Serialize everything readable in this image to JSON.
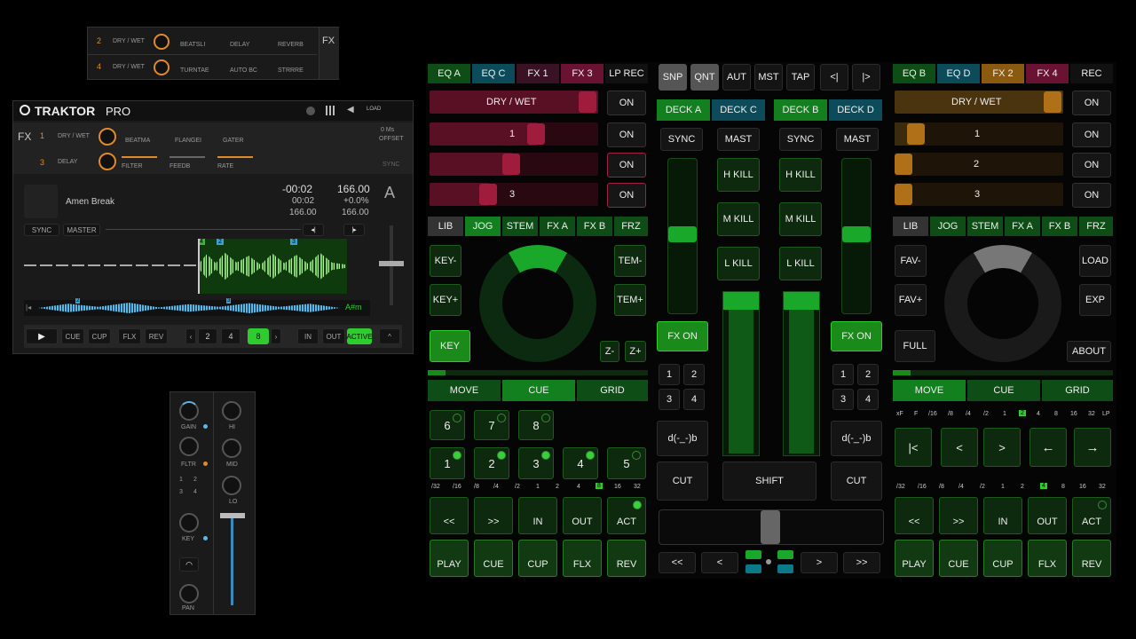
{
  "fx_mini": {
    "rows": [
      {
        "num": "2",
        "mode": "DRY / WET",
        "slots": [
          "BEATSLI",
          "DELAY",
          "REVERB"
        ]
      },
      {
        "num": "4",
        "mode": "DRY / WET",
        "slots": [
          "TURNTAE",
          "AUTO BC",
          "STRRRE"
        ]
      }
    ],
    "fx_label": "FX"
  },
  "traktor": {
    "logo": "TRAKTOR",
    "logo_suffix": "PRO",
    "load_label": "LOAD",
    "fx_label": "FX",
    "fx_rows": [
      {
        "num": "1",
        "mode": "DRY / WET",
        "slots": [
          "BEATMA",
          "FLANGEI",
          "GATER"
        ]
      },
      {
        "num": "3",
        "mode": "DELAY",
        "slots": [
          "FILTER",
          "FEEDB",
          "RATE"
        ]
      }
    ],
    "offset_ms": "0 Ms",
    "offset_label": "OFFSET",
    "sync_label": "SYNC",
    "track": {
      "title": "Amen Break",
      "time_remaining": "-00:02",
      "bpm": "166.00",
      "time": "00:02",
      "pitch": "+0.0%",
      "bpm2": "166.00",
      "bpm3": "166.00",
      "deck_letter": "A",
      "key": "A#m"
    },
    "buttons": {
      "sync": "SYNC",
      "master": "MASTER"
    },
    "transport": {
      "cue": "CUE",
      "cup": "CUP",
      "flx": "FLX",
      "rev": "REV",
      "loop_sizes": [
        "2",
        "4",
        "8"
      ],
      "in": "IN",
      "out": "OUT",
      "active": "ACTIVE"
    },
    "cue_markers": [
      "4",
      "2",
      "3",
      "2",
      "3"
    ]
  },
  "mixer_strip": {
    "gain": "GAIN",
    "filter": "FLTR",
    "key": "KEY",
    "pan": "PAN",
    "hi": "HI",
    "mid": "MID",
    "lo": "LO",
    "fx_assign": [
      "1",
      "2",
      "3",
      "4"
    ]
  },
  "controller": {
    "left": {
      "tabs": [
        "EQ A",
        "EQ C",
        "FX 1",
        "FX 3",
        "LP REC"
      ],
      "drywet": "DRY / WET",
      "rows": [
        "1",
        "2",
        "3"
      ],
      "on": "ON",
      "modes": [
        "LIB",
        "JOG",
        "STEM",
        "FX A",
        "FX B",
        "FRZ"
      ],
      "key_minus": "KEY-",
      "key_plus": "KEY+",
      "key": "KEY",
      "tem_minus": "TEM-",
      "tem_plus": "TEM+",
      "z_minus": "Z-",
      "z_plus": "Z+",
      "cue_modes": [
        "MOVE",
        "CUE",
        "GRID"
      ],
      "pads_top": [
        "6",
        "7",
        "8"
      ],
      "pads_bottom": [
        "1",
        "2",
        "3",
        "4",
        "5"
      ],
      "loop_sizes": [
        "/32",
        "/16",
        "/8",
        "/4",
        "/2",
        "1",
        "2",
        "4",
        "8",
        "16",
        "32"
      ],
      "loop_active": "8",
      "nav": [
        "<<",
        ">>",
        "IN",
        "OUT",
        "ACT"
      ],
      "transport": [
        "PLAY",
        "CUE",
        "CUP",
        "FLX",
        "REV"
      ]
    },
    "center": {
      "top": [
        "SNP",
        "QNT",
        "AUT",
        "MST",
        "TAP",
        "<|",
        "|>"
      ],
      "decks": [
        "DECK A",
        "DECK C",
        "DECK B",
        "DECK D"
      ],
      "sync": "SYNC",
      "mast": "MAST",
      "kills": [
        "H KILL",
        "M KILL",
        "L KILL"
      ],
      "fx_on": "FX ON",
      "fx_nums": [
        "1",
        "2",
        "3",
        "4"
      ],
      "dub": "d(-_-)b",
      "cut": "CUT",
      "shift": "SHIFT",
      "bottom_nav": [
        "<<",
        "<",
        ">",
        ">>"
      ]
    },
    "right": {
      "tabs": [
        "EQ B",
        "EQ D",
        "FX 2",
        "FX 4",
        "REC"
      ],
      "drywet": "DRY / WET",
      "rows": [
        "1",
        "2",
        "3"
      ],
      "on": "ON",
      "modes": [
        "LIB",
        "JOG",
        "STEM",
        "FX A",
        "FX B",
        "FRZ"
      ],
      "fav_minus": "FAV-",
      "fav_plus": "FAV+",
      "full": "FULL",
      "load": "LOAD",
      "exp": "EXP",
      "about": "ABOUT",
      "cue_modes": [
        "MOVE",
        "CUE",
        "GRID"
      ],
      "move_sizes": [
        "xF",
        "F",
        "/16",
        "/8",
        "/4",
        "/2",
        "1",
        "2",
        "4",
        "8",
        "16",
        "32",
        "LP"
      ],
      "move_active": "2",
      "move_nav": [
        "|<",
        "<",
        ">",
        "←",
        "→"
      ],
      "loop_sizes": [
        "/32",
        "/16",
        "/8",
        "/4",
        "/2",
        "1",
        "2",
        "4",
        "8",
        "16",
        "32"
      ],
      "loop_active": "4",
      "nav": [
        "<<",
        ">>",
        "IN",
        "OUT",
        "ACT"
      ],
      "transport": [
        "PLAY",
        "CUE",
        "CUP",
        "FLX",
        "REV"
      ]
    }
  }
}
